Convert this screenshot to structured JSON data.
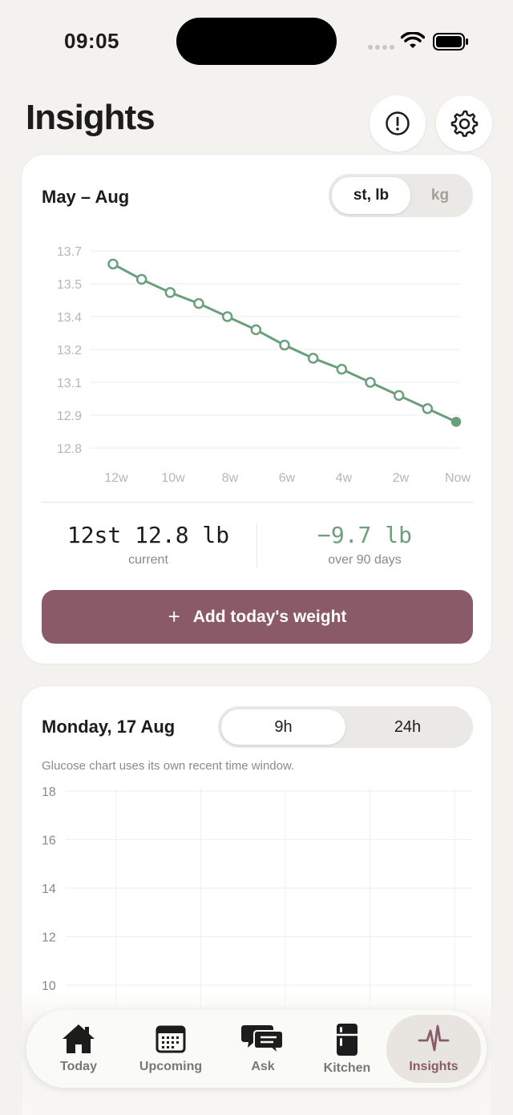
{
  "status_bar": {
    "time": "09:05"
  },
  "header": {
    "title": "Insights",
    "info_icon": "alert-circle-icon",
    "settings_icon": "gear-icon"
  },
  "weight_card": {
    "title": "May – Aug",
    "unit_toggle": {
      "options": [
        "st, lb",
        "kg"
      ],
      "selected": "st, lb"
    },
    "current_value": "12st 12.8 lb",
    "current_label": "current",
    "change_value": "−9.7 lb",
    "change_label": "over 90 days",
    "add_button": "Add today's weight",
    "add_icon": "+"
  },
  "chart_data": [
    {
      "type": "line",
      "title": "",
      "xlabel": "",
      "ylabel": "",
      "x_tick_labels": [
        "12w",
        "10w",
        "8w",
        "6w",
        "4w",
        "2w",
        "Now"
      ],
      "y_tick_labels": [
        "13.7",
        "13.5",
        "13.4",
        "13.2",
        "13.1",
        "12.9",
        "12.8"
      ],
      "ylim": [
        12.8,
        13.7
      ],
      "grid": true,
      "line_color": "#6a9f7c",
      "series": [
        {
          "values": [
            13.64,
            13.57,
            13.51,
            13.46,
            13.4,
            13.34,
            13.27,
            13.21,
            13.16,
            13.1,
            13.04,
            12.98,
            12.92
          ]
        }
      ]
    },
    {
      "type": "line",
      "title": "",
      "y_tick_labels": [
        "18",
        "16",
        "14",
        "12",
        "10"
      ],
      "ylim": [
        8,
        18
      ],
      "grid": true,
      "series": []
    }
  ],
  "glucose_card": {
    "title": "Monday, 17 Aug",
    "range_toggle": {
      "options": [
        "9h",
        "24h"
      ],
      "selected": "9h"
    },
    "note": "Glucose chart uses its own recent time window."
  },
  "tab_bar": {
    "tabs": [
      {
        "label": "Today",
        "icon": "house-icon"
      },
      {
        "label": "Upcoming",
        "icon": "calendar-icon"
      },
      {
        "label": "Ask",
        "icon": "chat-bubbles-icon"
      },
      {
        "label": "Kitchen",
        "icon": "fridge-icon"
      },
      {
        "label": "Insights",
        "icon": "pulse-icon"
      }
    ],
    "active": "Insights",
    "active_color": "#8a5a68"
  }
}
